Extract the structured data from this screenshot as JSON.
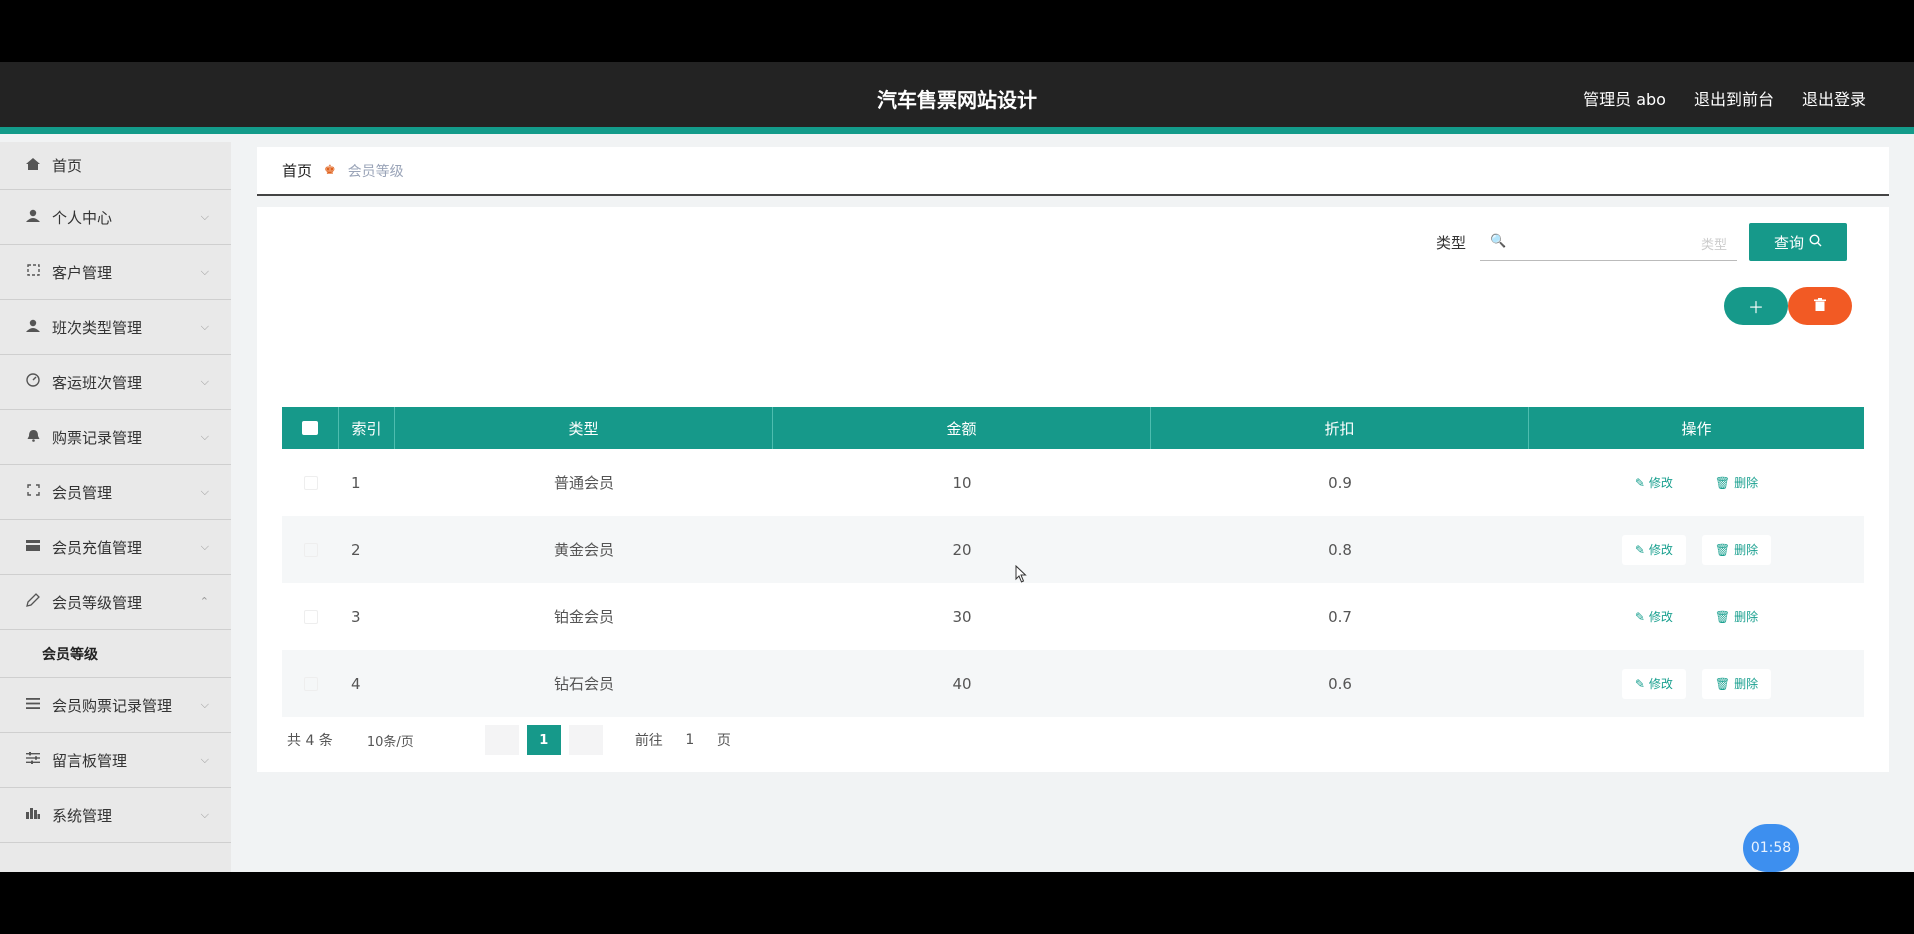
{
  "header": {
    "title": "汽车售票网站设计",
    "admin_label": "管理员 abo",
    "exit_front_label": "退出到前台",
    "logout_label": "退出登录"
  },
  "sidebar": {
    "items": [
      {
        "label": "首页",
        "icon": "home-icon"
      },
      {
        "label": "个人中心",
        "icon": "user-icon"
      },
      {
        "label": "客户管理",
        "icon": "frame-icon"
      },
      {
        "label": "班次类型管理",
        "icon": "user-icon"
      },
      {
        "label": "客运班次管理",
        "icon": "gauge-icon"
      },
      {
        "label": "购票记录管理",
        "icon": "bell-icon"
      },
      {
        "label": "会员管理",
        "icon": "frame-icon"
      },
      {
        "label": "会员充值管理",
        "icon": "card-icon"
      },
      {
        "label": "会员等级管理",
        "icon": "edit-icon"
      },
      {
        "label": "会员购票记录管理",
        "icon": "list-icon"
      },
      {
        "label": "留言板管理",
        "icon": "sliders-icon"
      },
      {
        "label": "系统管理",
        "icon": "bar-chart-icon"
      }
    ],
    "sub_item": "会员等级"
  },
  "breadcrumb": {
    "home": "首页",
    "current": "会员等级"
  },
  "search": {
    "label": "类型",
    "prefix": "🔍",
    "placeholder": "类型",
    "button": "查询"
  },
  "table": {
    "headers": [
      "索引",
      "类型",
      "金额",
      "折扣",
      "操作"
    ],
    "rows": [
      {
        "index": "1",
        "type": "普通会员",
        "amount": "10",
        "discount": "0.9"
      },
      {
        "index": "2",
        "type": "黄金会员",
        "amount": "20",
        "discount": "0.8"
      },
      {
        "index": "3",
        "type": "铂金会员",
        "amount": "30",
        "discount": "0.7"
      },
      {
        "index": "4",
        "type": "钻石会员",
        "amount": "40",
        "discount": "0.6"
      }
    ],
    "edit_label": "修改",
    "delete_label": "删除"
  },
  "pagination": {
    "total": "共 4 条",
    "page_size": "10条/页",
    "current_page": "1",
    "goto_label": "前往",
    "goto_value": "1",
    "page_unit": "页"
  },
  "timer": "01:58",
  "colors": {
    "accent": "#16998a",
    "danger": "#f25a24",
    "header_bg": "#232323"
  }
}
